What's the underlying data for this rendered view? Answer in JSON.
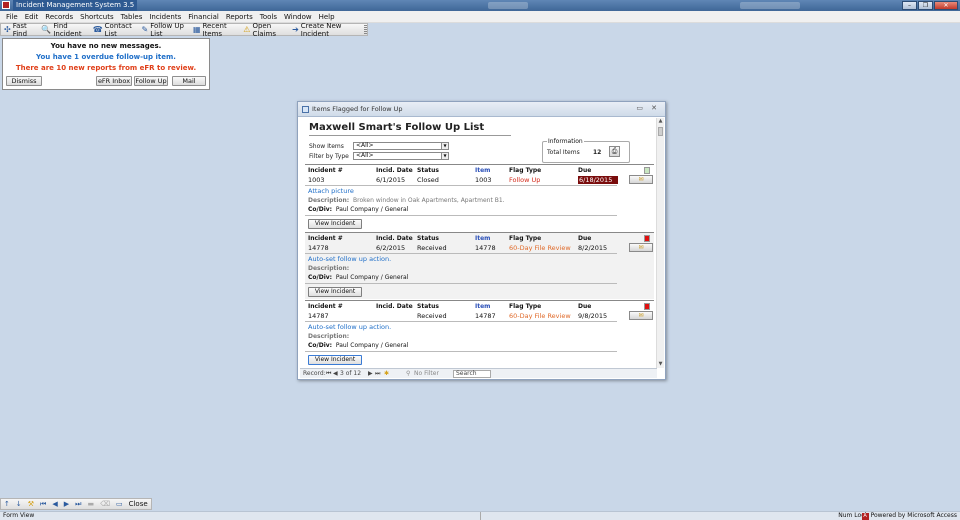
{
  "window": {
    "title": "Incident Management System 3.5",
    "controls": {
      "minimize": "–",
      "restore": "❐",
      "close": "✕"
    }
  },
  "menu": [
    "File",
    "Edit",
    "Records",
    "Shortcuts",
    "Tables",
    "Incidents",
    "Financial",
    "Reports",
    "Tools",
    "Window",
    "Help"
  ],
  "toolbar": [
    {
      "icon": "fast-find-icon",
      "glyph": "✣",
      "label": "Fast Find"
    },
    {
      "icon": "magnifier-icon",
      "glyph": "🔍",
      "label": "Find Incident"
    },
    {
      "icon": "contacts-icon",
      "glyph": "☎",
      "label": "Contact List"
    },
    {
      "icon": "pencil-icon",
      "glyph": "✎",
      "label": "Follow Up List"
    },
    {
      "icon": "recent-items-icon",
      "glyph": "▦",
      "label": "Recent Items"
    },
    {
      "icon": "claims-icon",
      "glyph": "⚠",
      "label": "Open Claims"
    },
    {
      "icon": "new-incident-icon",
      "glyph": "➔",
      "label": "Create New Incident"
    }
  ],
  "notifications": {
    "line1": "You have no new messages.",
    "line2": "You have 1 overdue follow-up item.",
    "line3": "There are 10 new reports from eFR to review.",
    "buttons": {
      "dismiss": "Dismiss",
      "efr_inbox": "eFR Inbox",
      "follow_up": "Follow Up",
      "mail": "Mail"
    }
  },
  "form": {
    "window_title": "Items Flagged for Follow Up",
    "heading": "Maxwell Smart's Follow Up List",
    "show_items_label": "Show Items",
    "show_items_value": "<All>",
    "filter_label": "Filter by Type",
    "filter_value": "<All>",
    "info_legend": "Information",
    "total_items_label": "Total Items",
    "total_items_value": "12",
    "columns": {
      "incident": "Incident #",
      "date": "Incid. Date",
      "status": "Status",
      "item": "Item",
      "flag_type": "Flag Type",
      "due": "Due"
    },
    "description_label": "Description:",
    "codiv_label": "Co/Div:",
    "view_button": "View Incident",
    "records": [
      {
        "incident": "1003",
        "date": "6/1/2015",
        "status": "Closed",
        "item": "1003",
        "flag_type": "Follow Up",
        "due": "6/18/2015",
        "note": "Attach picture",
        "description": "Broken window in Oak Apartments, Apartment B1.",
        "codiv": "Paul Company / General",
        "flag_color": "#c8e6c0",
        "due_overdue": true
      },
      {
        "incident": "14778",
        "date": "6/2/2015",
        "status": "Received",
        "item": "14778",
        "flag_type": "60-Day File Review",
        "due": "8/2/2015",
        "note": "Auto-set follow up action.",
        "description": "",
        "codiv": "Paul Company / General",
        "flag_color": "#e01010",
        "due_overdue": false
      },
      {
        "incident": "14787",
        "date": "",
        "status": "Received",
        "item": "14787",
        "flag_type": "60-Day File Review",
        "due": "9/8/2015",
        "note": "Auto-set follow up action.",
        "description": "",
        "codiv": "Paul Company / General",
        "flag_color": "#e01010",
        "due_overdue": false
      }
    ]
  },
  "record_nav": {
    "label": "Record:",
    "position": "3 of 12",
    "no_filter": "No Filter",
    "search": "Search"
  },
  "bottom_toolbar": {
    "close": "Close"
  },
  "statusbar": {
    "left": "Form View",
    "numlock": "Num Lock",
    "powered": "Powered by Microsoft Access"
  }
}
